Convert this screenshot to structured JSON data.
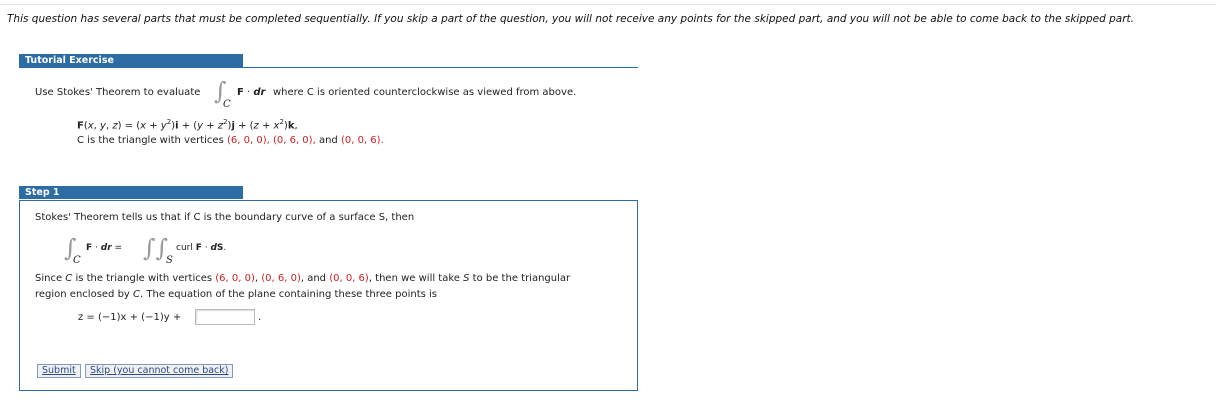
{
  "notice": "This question has several parts that must be completed sequentially. If you skip a part of the question, you will not receive any points for the skipped part, and you will not be able to come back to the skipped part.",
  "tutorial": {
    "tab_label": "Tutorial Exercise",
    "prompt_before": "Use Stokes' Theorem to evaluate",
    "integral_sub": "C",
    "integrand": "F · dr",
    "prompt_after": "where C is oriented counterclockwise as viewed from above.",
    "field_F": "F(x, y, z) = (x + y²)i + (y + z²)j + (z + x²)k,",
    "curve_prefix": "C is the triangle with vertices",
    "v1": "(6, 0, 0),",
    "v2": "(0, 6, 0),",
    "and": "and",
    "v3": "(0, 0, 6)."
  },
  "step1": {
    "tab_label": "Step 1",
    "theorem_text": "Stokes' Theorem tells us that if C is the boundary curve of a surface S, then",
    "lhs": "F · dr =",
    "lhs_sub": "C",
    "rhs": "curl F · dS.",
    "rhs_sub": "S",
    "since_line1": "Since C is the triangle with vertices (6, 0, 0), (0, 6, 0), and (0, 0, 6), then we will take S to be the triangular",
    "since_line2": "region enclosed by C. The equation of the plane containing these three points is",
    "equation": "z = (−1)x + (−1)y +",
    "answer_value": "",
    "period": ".",
    "submit_label": "Submit",
    "skip_label": "Skip (you cannot come back)"
  }
}
